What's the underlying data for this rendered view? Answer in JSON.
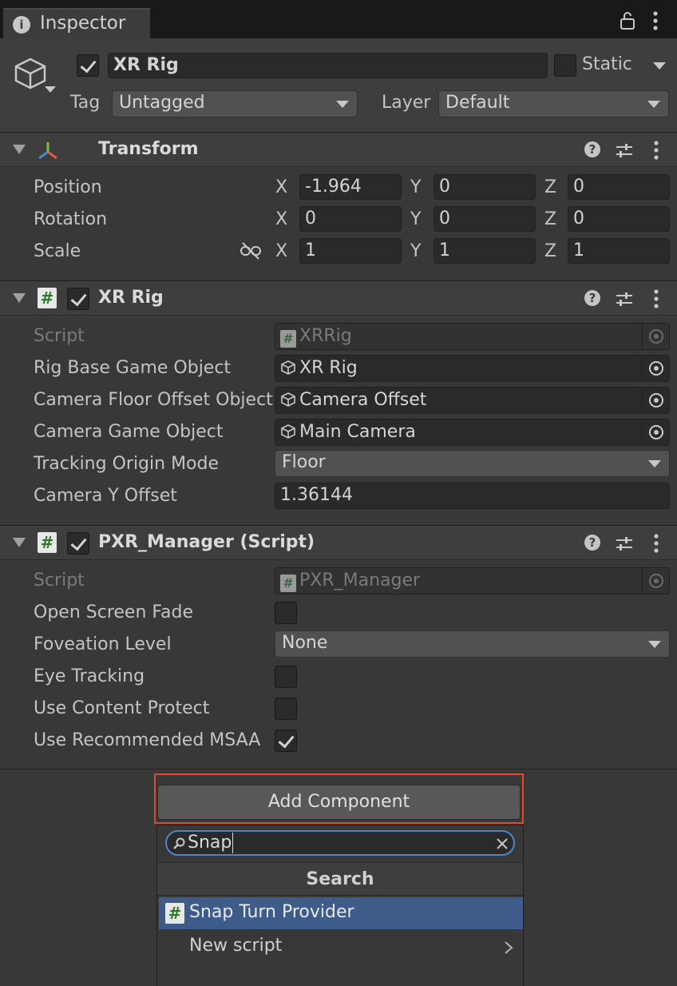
{
  "tab": {
    "title": "Inspector"
  },
  "object": {
    "name": "XR Rig",
    "static_label": "Static",
    "tag_label": "Tag",
    "tag_value": "Untagged",
    "layer_label": "Layer",
    "layer_value": "Default"
  },
  "transform": {
    "title": "Transform",
    "position": {
      "label": "Position",
      "x": "-1.964",
      "y": "0",
      "z": "0"
    },
    "rotation": {
      "label": "Rotation",
      "x": "0",
      "y": "0",
      "z": "0"
    },
    "scale": {
      "label": "Scale",
      "x": "1",
      "y": "1",
      "z": "1"
    },
    "axis": {
      "x": "X",
      "y": "Y",
      "z": "Z"
    }
  },
  "xrrig": {
    "title": "XR Rig",
    "script_label": "Script",
    "script_value": "XRRig",
    "rig_base_label": "Rig Base Game Object",
    "rig_base_value": "XR Rig",
    "floor_offset_label": "Camera Floor Offset Object",
    "floor_offset_value": "Camera Offset",
    "camera_go_label": "Camera Game Object",
    "camera_go_value": "Main Camera",
    "tracking_label": "Tracking Origin Mode",
    "tracking_value": "Floor",
    "y_offset_label": "Camera Y Offset",
    "y_offset_value": "1.36144"
  },
  "pxr": {
    "title": "PXR_Manager (Script)",
    "script_label": "Script",
    "script_value": "PXR_Manager",
    "fade_label": "Open Screen Fade",
    "foveation_label": "Foveation Level",
    "foveation_value": "None",
    "eye_label": "Eye Tracking",
    "content_label": "Use Content Protect",
    "msaa_label": "Use Recommended MSAA"
  },
  "add_component": {
    "button_label": "Add Component",
    "search_value": "Snap",
    "section_title": "Search",
    "results": [
      "Snap Turn Provider",
      "New script"
    ]
  },
  "colors": {
    "accent_frame": "#e04a2c",
    "selection": "#3e5c8a",
    "search_focus": "#4f86c6"
  }
}
